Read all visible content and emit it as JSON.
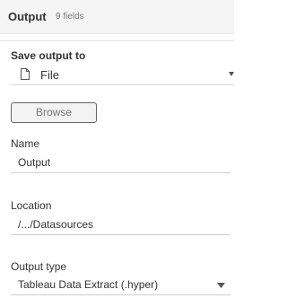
{
  "header": {
    "title": "Output",
    "field_count": "9 fields"
  },
  "save_output": {
    "label": "Save output to",
    "selected": "File",
    "icon": "file-icon"
  },
  "browse": {
    "label": "Browse"
  },
  "name_field": {
    "label": "Name",
    "value": "Output"
  },
  "location_field": {
    "label": "Location",
    "value": "/.../Datasources"
  },
  "output_type": {
    "label": "Output type",
    "selected": "Tableau Data Extract (.hyper)"
  },
  "colors": {
    "header_bg": "#f5f5f5",
    "text": "#333333",
    "muted": "#777777"
  }
}
